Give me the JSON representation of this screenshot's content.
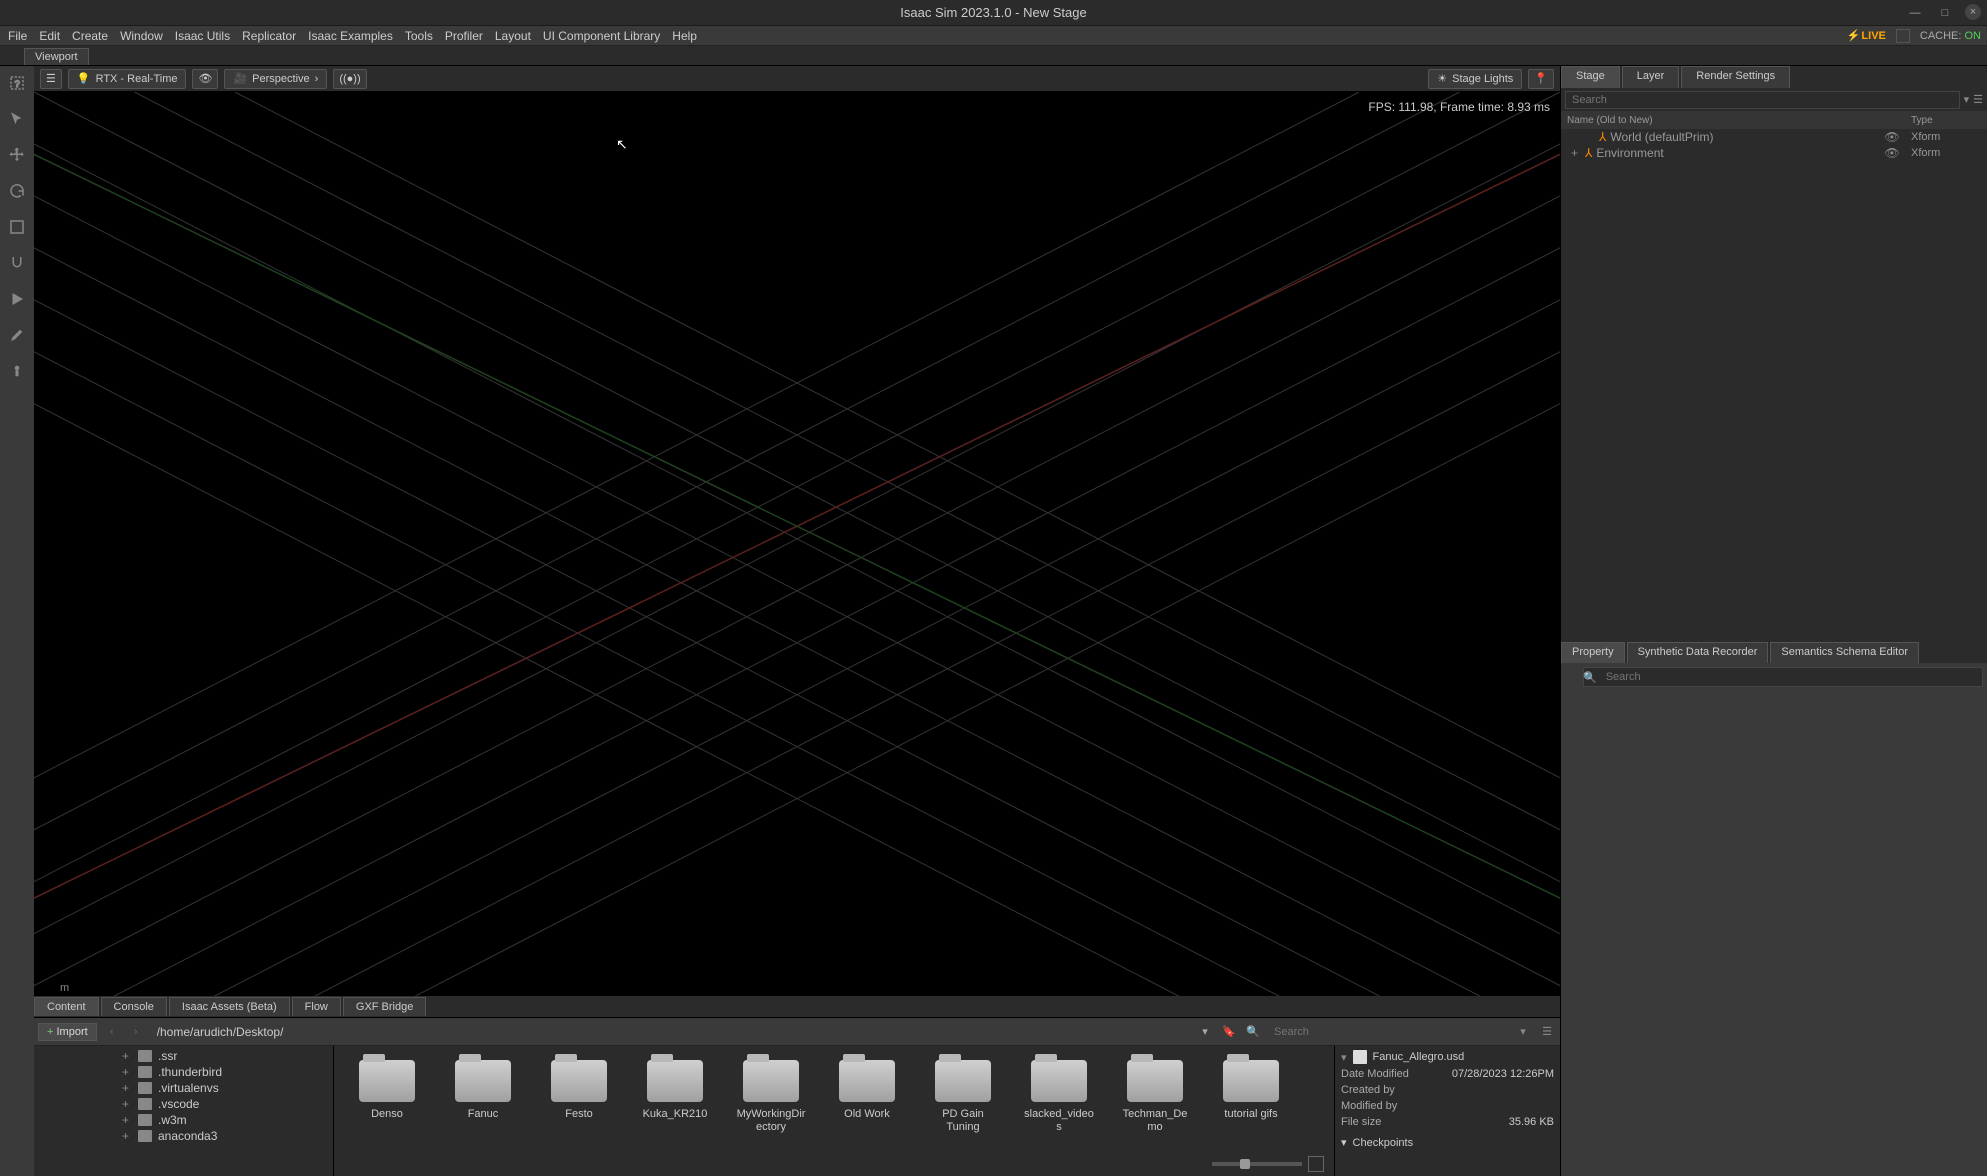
{
  "title": "Isaac Sim 2023.1.0 - New Stage",
  "menu": [
    "File",
    "Edit",
    "Create",
    "Window",
    "Isaac Utils",
    "Replicator",
    "Isaac Examples",
    "Tools",
    "Profiler",
    "Layout",
    "UI Component Library",
    "Help"
  ],
  "status": {
    "live": "LIVE",
    "cache_label": "CACHE:",
    "cache_value": "ON"
  },
  "viewport_tab": "Viewport",
  "vp_toolbar": {
    "renderer": "RTX - Real-Time",
    "camera": "Perspective",
    "lights": "Stage Lights"
  },
  "viewport": {
    "fps": "FPS: 111.98, Frame time: 8.93 ms",
    "units": "m"
  },
  "bottom_tabs": [
    "Content",
    "Console",
    "Isaac Assets (Beta)",
    "Flow",
    "GXF Bridge"
  ],
  "import_label": "Import",
  "path": "/home/arudich/Desktop/",
  "content_search_placeholder": "Search",
  "tree": [
    ".ssr",
    ".thunderbird",
    ".virtualenvs",
    ".vscode",
    ".w3m",
    "anaconda3"
  ],
  "folders": [
    "Denso",
    "Fanuc",
    "Festo",
    "Kuka_KR210",
    "MyWorkingDirectory",
    "Old Work",
    "PD Gain Tuning",
    "slacked_videos",
    "Techman_Demo",
    "tutorial gifs"
  ],
  "details": {
    "filename": "Fanuc_Allegro.usd",
    "date_modified_k": "Date Modified",
    "date_modified_v": "07/28/2023 12:26PM",
    "created_by_k": "Created by",
    "modified_by_k": "Modified by",
    "filesize_k": "File size",
    "filesize_v": "35.96 KB",
    "checkpoints": "Checkpoints"
  },
  "right_tabs": [
    "Stage",
    "Layer",
    "Render Settings"
  ],
  "stage_search_placeholder": "Search",
  "stage_header": {
    "name": "Name (Old to New)",
    "type": "Type"
  },
  "stage_rows": [
    {
      "name": "World (defaultPrim)",
      "type": "Xform",
      "indent": 1,
      "exp": ""
    },
    {
      "name": "Environment",
      "type": "Xform",
      "indent": 1,
      "exp": "+"
    }
  ],
  "prop_tabs": [
    "Property",
    "Synthetic Data Recorder",
    "Semantics Schema Editor"
  ],
  "prop_search_placeholder": "Search"
}
